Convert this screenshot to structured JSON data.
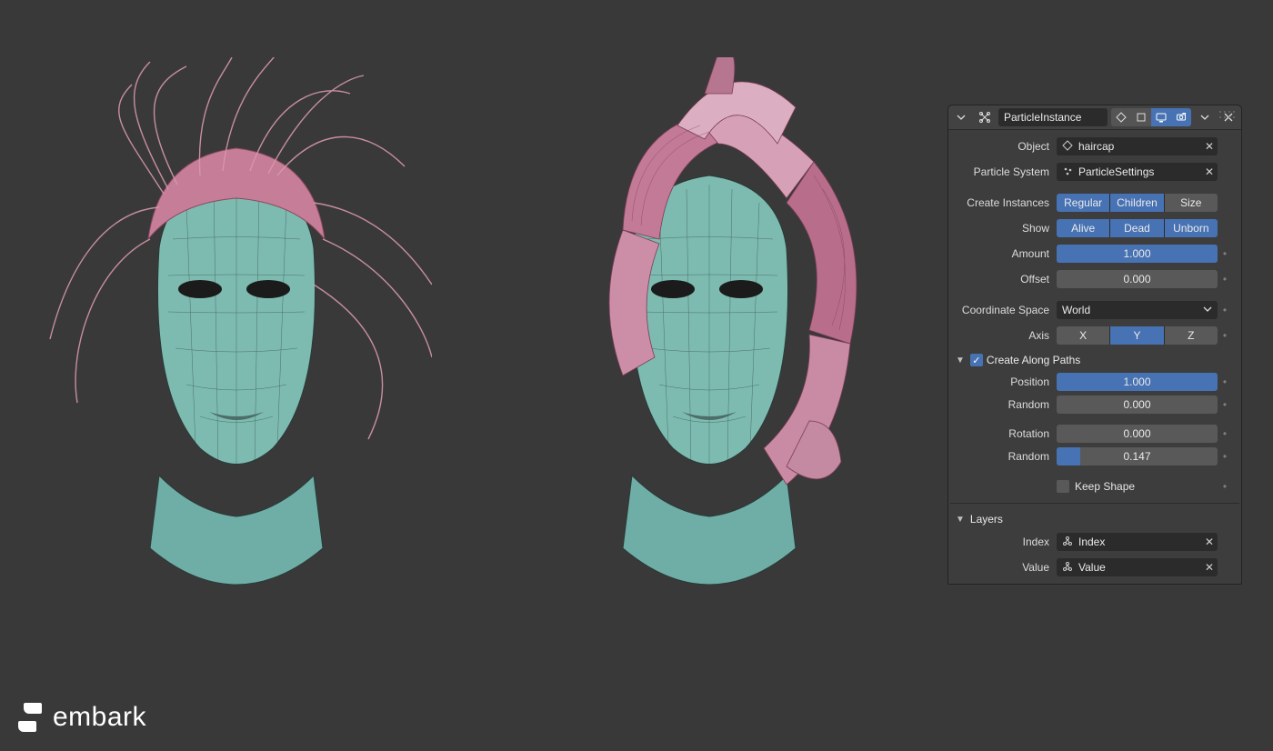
{
  "logo": {
    "text": "embark"
  },
  "modifier": {
    "title": "ParticleInstance",
    "object_label": "Object",
    "object_value": "haircap",
    "particle_system_label": "Particle System",
    "particle_system_value": "ParticleSettings",
    "create_instances_label": "Create Instances",
    "create_instances": [
      {
        "label": "Regular",
        "active": true
      },
      {
        "label": "Children",
        "active": true
      },
      {
        "label": "Size",
        "active": false
      }
    ],
    "show_label": "Show",
    "show": [
      {
        "label": "Alive",
        "active": true
      },
      {
        "label": "Dead",
        "active": true
      },
      {
        "label": "Unborn",
        "active": true
      }
    ],
    "amount_label": "Amount",
    "amount_value": "1.000",
    "amount_fill": 100,
    "offset_label": "Offset",
    "offset_value": "0.000",
    "offset_fill": 0,
    "coord_space_label": "Coordinate Space",
    "coord_space_value": "World",
    "axis_label": "Axis",
    "axis": [
      {
        "label": "X",
        "active": false
      },
      {
        "label": "Y",
        "active": true
      },
      {
        "label": "Z",
        "active": false
      }
    ],
    "create_along_paths_label": "Create Along Paths",
    "create_along_paths_checked": true,
    "position_label": "Position",
    "position_value": "1.000",
    "position_fill": 100,
    "position_random_label": "Random",
    "position_random_value": "0.000",
    "position_random_fill": 0,
    "rotation_label": "Rotation",
    "rotation_value": "0.000",
    "rotation_fill": 0,
    "rotation_random_label": "Random",
    "rotation_random_value": "0.147",
    "rotation_random_fill": 14.7,
    "keep_shape_label": "Keep Shape",
    "keep_shape_checked": false,
    "layers_label": "Layers",
    "layers_index_label": "Index",
    "layers_index_value": "Index",
    "layers_value_label": "Value",
    "layers_value_value": "Value"
  }
}
